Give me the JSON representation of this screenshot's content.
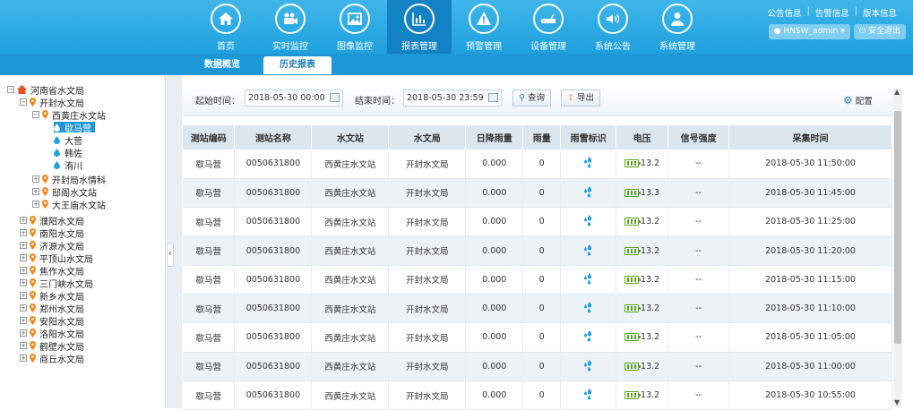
{
  "nav": [
    {
      "label": "首页",
      "icon": "home-icon"
    },
    {
      "label": "实时监控",
      "icon": "video-camera-icon"
    },
    {
      "label": "图像监控",
      "icon": "image-icon"
    },
    {
      "label": "报表管理",
      "icon": "bar-chart-icon",
      "active": true
    },
    {
      "label": "预警管理",
      "icon": "warning-icon"
    },
    {
      "label": "设备管理",
      "icon": "router-icon"
    },
    {
      "label": "系统公告",
      "icon": "speaker-icon"
    },
    {
      "label": "系统管理",
      "icon": "user-icon"
    }
  ],
  "toplinks": {
    "notice": "公告信息",
    "alarm": "告警信息",
    "version": "版本信息",
    "sep": "|"
  },
  "user": {
    "name": "HNSW_admin",
    "logout": "安全退出"
  },
  "subtabs": {
    "overview": "数据概览",
    "history": "历史报表"
  },
  "tree": [
    {
      "label": "河南省水文局",
      "level": 0,
      "pm": "⊟",
      "type": "home"
    },
    {
      "label": "开封水文局",
      "level": 1,
      "pm": "⊟",
      "type": "pin"
    },
    {
      "label": "西黄庄水文站",
      "level": 2,
      "pm": "⊟",
      "type": "pin"
    },
    {
      "label": "歇马营",
      "level": 3,
      "type": "drop",
      "selected": true
    },
    {
      "label": "大营",
      "level": 3,
      "type": "drop"
    },
    {
      "label": "韩佐",
      "level": 3,
      "type": "drop"
    },
    {
      "label": "洧川",
      "level": 3,
      "type": "drop"
    },
    {
      "label": "开封局水情科",
      "level": 2,
      "pm": "⊞",
      "type": "pin"
    },
    {
      "label": "邸阁水文站",
      "level": 2,
      "pm": "⊞",
      "type": "pin"
    },
    {
      "label": "大王庙水文站",
      "level": 2,
      "pm": "⊞",
      "type": "pin"
    },
    {
      "label": "濮阳水文局",
      "level": 1,
      "pm": "⊞",
      "type": "pin"
    },
    {
      "label": "南阳水文局",
      "level": 1,
      "pm": "⊞",
      "type": "pin"
    },
    {
      "label": "济源水文局",
      "level": 1,
      "pm": "⊞",
      "type": "pin"
    },
    {
      "label": "平顶山水文局",
      "level": 1,
      "pm": "⊞",
      "type": "pin"
    },
    {
      "label": "焦作水文局",
      "level": 1,
      "pm": "⊞",
      "type": "pin"
    },
    {
      "label": "三门峡水文局",
      "level": 1,
      "pm": "⊞",
      "type": "pin"
    },
    {
      "label": "新乡水文局",
      "level": 1,
      "pm": "⊞",
      "type": "pin"
    },
    {
      "label": "郑州水文局",
      "level": 1,
      "pm": "⊞",
      "type": "pin"
    },
    {
      "label": "安阳水文局",
      "level": 1,
      "pm": "⊞",
      "type": "pin"
    },
    {
      "label": "洛阳水文局",
      "level": 1,
      "pm": "⊞",
      "type": "pin"
    },
    {
      "label": "鹤壁水文局",
      "level": 1,
      "pm": "⊞",
      "type": "pin"
    },
    {
      "label": "商丘水文局",
      "level": 1,
      "pm": "⊞",
      "type": "pin"
    }
  ],
  "filter": {
    "start_label": "起始时间：",
    "start_value": "2018-05-30 00:00",
    "end_label": "结束时间：",
    "end_value": "2018-05-30 23:59",
    "query": "查询",
    "export": "导出",
    "config": "配置"
  },
  "table": {
    "headers": [
      "测站编码",
      "测站名称",
      "水文站",
      "水文局",
      "日降雨量",
      "雨量",
      "雨雪标识",
      "电压",
      "信号强度",
      "采集时间"
    ],
    "rows": [
      [
        "歇马营",
        "0050631800",
        "西黄庄水文站",
        "开封水文局",
        "0.000",
        "0",
        "13.2",
        "--",
        "2018-05-30 11:50:00"
      ],
      [
        "歇马营",
        "0050631800",
        "西黄庄水文站",
        "开封水文局",
        "0.000",
        "0",
        "13.3",
        "--",
        "2018-05-30 11:45:00"
      ],
      [
        "歇马营",
        "0050631800",
        "西黄庄水文站",
        "开封水文局",
        "0.000",
        "0",
        "13.2",
        "--",
        "2018-05-30 11:25:00"
      ],
      [
        "歇马营",
        "0050631800",
        "西黄庄水文站",
        "开封水文局",
        "0.000",
        "0",
        "13.2",
        "--",
        "2018-05-30 11:20:00"
      ],
      [
        "歇马营",
        "0050631800",
        "西黄庄水文站",
        "开封水文局",
        "0.000",
        "0",
        "13.2",
        "--",
        "2018-05-30 11:15:00"
      ],
      [
        "歇马营",
        "0050631800",
        "西黄庄水文站",
        "开封水文局",
        "0.000",
        "0",
        "13.2",
        "--",
        "2018-05-30 11:10:00"
      ],
      [
        "歇马营",
        "0050631800",
        "西黄庄水文站",
        "开封水文局",
        "0.000",
        "0",
        "13.2",
        "--",
        "2018-05-30 11:05:00"
      ],
      [
        "歇马营",
        "0050631800",
        "西黄庄水文站",
        "开封水文局",
        "0.000",
        "0",
        "13.2",
        "--",
        "2018-05-30 11:00:00"
      ],
      [
        "歇马营",
        "0050631800",
        "西黄庄水文站",
        "开封水文局",
        "0.000",
        "0",
        "13.2",
        "--",
        "2018-05-30 10:55:00"
      ]
    ]
  },
  "colors": {
    "topbar": "#1fa0de",
    "active_nav": "#1382c4",
    "subbar": "#1e97d7",
    "battery": "#5aa51e",
    "rain_icon": "#1ea0e0"
  }
}
